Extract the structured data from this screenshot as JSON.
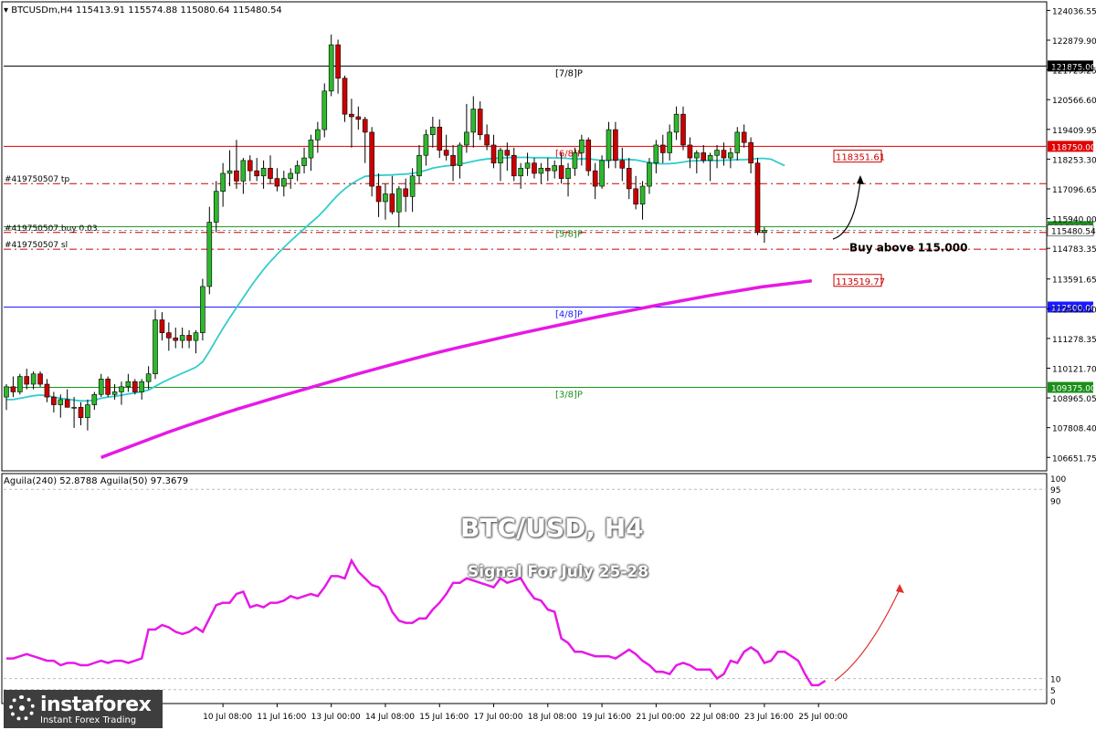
{
  "header": {
    "symbol": "BTCUSDm,H4",
    "ohlc": "115413.91 115574.88 115080.64 115480.54"
  },
  "indicator_header": "Aguila(240) 52.8788  Aguila(50) 97.3679",
  "watermark": {
    "title": "BTC/USD, H4",
    "subtitle": "Signal For July 25-28"
  },
  "logo": {
    "brand": "instaforex",
    "tagline": "Instant Forex Trading"
  },
  "colors": {
    "bull": "#2eb82e",
    "bear": "#cc0000",
    "ema_fast": "#33cccc",
    "ema_slow": "#e619e6",
    "murray_black": "#000000",
    "murray_red": "#e00000",
    "murray_green": "#1a8f1a",
    "murray_blue": "#1a1aff",
    "order_line": "#cc0000",
    "indicator": "#e619e6"
  },
  "chart_data": [
    {
      "type": "candlestick",
      "title": "BTCUSDm,H4",
      "ylim": [
        106200,
        124300
      ],
      "y_ticks": [
        124036.55,
        122879.9,
        121723.25,
        120566.6,
        119409.95,
        118253.3,
        117096.65,
        115940.0,
        114783.35,
        113591.65,
        112435.0,
        111278.35,
        110121.7,
        108965.05,
        107808.4,
        106651.75
      ],
      "x_tick_labels": [
        "10 Jul 08:00",
        "11 Jul 16:00",
        "13 Jul 00:00",
        "14 Jul 08:00",
        "15 Jul 16:00",
        "17 Jul 00:00",
        "18 Jul 08:00",
        "19 Jul 16:00",
        "21 Jul 00:00",
        "22 Jul 08:00",
        "23 Jul 16:00",
        "25 Jul 00:00"
      ],
      "x_tick_bar_index": [
        32,
        40,
        48,
        56,
        64,
        72,
        80,
        88,
        96,
        104,
        112,
        120
      ],
      "candles": [
        [
          109000,
          109500,
          108500,
          109400
        ],
        [
          109400,
          109800,
          109000,
          109200
        ],
        [
          109200,
          109900,
          109100,
          109800
        ],
        [
          109800,
          110100,
          109300,
          109500
        ],
        [
          109500,
          110000,
          109300,
          109900
        ],
        [
          109900,
          110000,
          109400,
          109500
        ],
        [
          109500,
          109700,
          108800,
          109000
        ],
        [
          109000,
          109200,
          108400,
          108700
        ],
        [
          108700,
          109100,
          108200,
          108900
        ],
        [
          108900,
          109300,
          108600,
          108600
        ],
        [
          108600,
          109000,
          107800,
          108600
        ],
        [
          108600,
          108800,
          107900,
          108200
        ],
        [
          108200,
          108900,
          107700,
          108700
        ],
        [
          108700,
          109200,
          108500,
          109100
        ],
        [
          109100,
          109900,
          109000,
          109700
        ],
        [
          109700,
          109800,
          109000,
          109100
        ],
        [
          109100,
          109500,
          108900,
          109200
        ],
        [
          109200,
          109600,
          108700,
          109400
        ],
        [
          109400,
          109900,
          109200,
          109600
        ],
        [
          109600,
          109700,
          109100,
          109200
        ],
        [
          109200,
          109700,
          108900,
          109600
        ],
        [
          109600,
          110200,
          109300,
          109900
        ],
        [
          109900,
          112400,
          109700,
          112000
        ],
        [
          112000,
          112300,
          111200,
          111500
        ],
        [
          111500,
          111900,
          110800,
          111300
        ],
        [
          111300,
          111700,
          110900,
          111200
        ],
        [
          111200,
          111700,
          110900,
          111400
        ],
        [
          111400,
          111600,
          110900,
          111200
        ],
        [
          111200,
          111600,
          110700,
          111500
        ],
        [
          111500,
          113600,
          111200,
          113300
        ],
        [
          113300,
          116400,
          113000,
          115800
        ],
        [
          115800,
          117400,
          115400,
          117000
        ],
        [
          117000,
          118100,
          116400,
          117700
        ],
        [
          117700,
          118600,
          117200,
          117800
        ],
        [
          117800,
          119000,
          117100,
          117400
        ],
        [
          117400,
          118300,
          116900,
          118200
        ],
        [
          118200,
          118400,
          117400,
          117800
        ],
        [
          117800,
          118300,
          117400,
          117600
        ],
        [
          117600,
          118200,
          117100,
          117900
        ],
        [
          117900,
          118400,
          117300,
          117500
        ],
        [
          117500,
          117900,
          117000,
          117200
        ],
        [
          117200,
          117800,
          116800,
          117500
        ],
        [
          117500,
          117900,
          117100,
          117700
        ],
        [
          117700,
          118200,
          117400,
          118000
        ],
        [
          118000,
          118700,
          117700,
          118300
        ],
        [
          118300,
          119200,
          117800,
          119000
        ],
        [
          119000,
          119700,
          118500,
          119400
        ],
        [
          119400,
          121200,
          119100,
          120900
        ],
        [
          120900,
          123100,
          120700,
          122700
        ],
        [
          122700,
          122900,
          120800,
          121400
        ],
        [
          121400,
          121500,
          119700,
          120000
        ],
        [
          120000,
          120600,
          118700,
          119900
        ],
        [
          119900,
          120300,
          119400,
          119800
        ],
        [
          119800,
          119900,
          118100,
          119300
        ],
        [
          119300,
          119500,
          116800,
          117200
        ],
        [
          117200,
          117700,
          116000,
          116600
        ],
        [
          116600,
          117300,
          115900,
          116900
        ],
        [
          116900,
          117600,
          116100,
          116200
        ],
        [
          116200,
          117200,
          115600,
          117100
        ],
        [
          117100,
          117500,
          116200,
          116800
        ],
        [
          116800,
          117900,
          116200,
          117600
        ],
        [
          117600,
          118800,
          117300,
          118400
        ],
        [
          118400,
          119400,
          118000,
          119200
        ],
        [
          119200,
          119900,
          118700,
          119500
        ],
        [
          119500,
          119800,
          118300,
          118600
        ],
        [
          118600,
          119200,
          118200,
          118400
        ],
        [
          118400,
          118800,
          117400,
          118000
        ],
        [
          118000,
          118900,
          117500,
          118800
        ],
        [
          118800,
          120400,
          118500,
          119300
        ],
        [
          119300,
          120700,
          118700,
          120200
        ],
        [
          120200,
          120500,
          119000,
          119200
        ],
        [
          119200,
          119600,
          118600,
          118800
        ],
        [
          118800,
          119200,
          117900,
          118100
        ],
        [
          118100,
          118700,
          117400,
          118600
        ],
        [
          118600,
          118900,
          117800,
          118400
        ],
        [
          118400,
          118700,
          117400,
          117600
        ],
        [
          117600,
          118100,
          117100,
          117900
        ],
        [
          117900,
          118500,
          117600,
          118100
        ],
        [
          118100,
          118300,
          117500,
          117700
        ],
        [
          117700,
          118100,
          117300,
          117900
        ],
        [
          117900,
          118300,
          117400,
          117800
        ],
        [
          117800,
          118200,
          117500,
          118000
        ],
        [
          118000,
          118500,
          117300,
          117500
        ],
        [
          117500,
          118100,
          116800,
          117900
        ],
        [
          117900,
          118700,
          117600,
          118500
        ],
        [
          118500,
          119200,
          118000,
          119000
        ],
        [
          119000,
          119100,
          117600,
          117800
        ],
        [
          117800,
          118100,
          116700,
          117200
        ],
        [
          117200,
          118400,
          117100,
          118200
        ],
        [
          118200,
          119700,
          117900,
          119400
        ],
        [
          119400,
          119700,
          117900,
          118200
        ],
        [
          118200,
          118700,
          117400,
          117900
        ],
        [
          117900,
          118300,
          116700,
          117100
        ],
        [
          117100,
          117600,
          116300,
          116500
        ],
        [
          116500,
          117400,
          115900,
          117200
        ],
        [
          117200,
          118300,
          116900,
          118100
        ],
        [
          118100,
          119000,
          117700,
          118800
        ],
        [
          118800,
          119200,
          118100,
          118500
        ],
        [
          118500,
          119600,
          118200,
          119300
        ],
        [
          119300,
          120300,
          119000,
          120000
        ],
        [
          120000,
          120300,
          118600,
          118800
        ],
        [
          118800,
          119100,
          117900,
          118300
        ],
        [
          118300,
          118600,
          117700,
          118500
        ],
        [
          118500,
          118800,
          118100,
          118200
        ],
        [
          118200,
          118500,
          117400,
          118400
        ],
        [
          118400,
          118800,
          117900,
          118600
        ],
        [
          118600,
          118900,
          118000,
          118300
        ],
        [
          118300,
          118700,
          117900,
          118500
        ],
        [
          118500,
          119500,
          118200,
          119300
        ],
        [
          119300,
          119600,
          118700,
          118900
        ],
        [
          118900,
          119100,
          117700,
          118100
        ],
        [
          118100,
          118300,
          115300,
          115400
        ],
        [
          115400,
          115600,
          115000,
          115480
        ]
      ],
      "ema_fast_values": [
        108900,
        108900,
        108950,
        109000,
        109050,
        109080,
        109050,
        109000,
        108950,
        108920,
        108880,
        108850,
        108850,
        108880,
        108950,
        109000,
        109030,
        109070,
        109120,
        109160,
        109210,
        109270,
        109420,
        109560,
        109690,
        109810,
        109930,
        110040,
        110160,
        110370,
        110780,
        111230,
        111670,
        112080,
        112470,
        112870,
        113260,
        113620,
        113960,
        114270,
        114550,
        114820,
        115070,
        115310,
        115540,
        115780,
        116010,
        116280,
        116580,
        116860,
        117100,
        117290,
        117450,
        117580,
        117610,
        117620,
        117630,
        117640,
        117660,
        117670,
        117700,
        117750,
        117820,
        117900,
        117950,
        117990,
        118020,
        118060,
        118110,
        118170,
        118220,
        118260,
        118280,
        118300,
        118310,
        118320,
        118320,
        118320,
        118310,
        118310,
        118310,
        118300,
        118300,
        118280,
        118260,
        118260,
        118270,
        118230,
        118200,
        118200,
        118240,
        118240,
        118240,
        118220,
        118170,
        118120,
        118080,
        118070,
        118080,
        118100,
        118140,
        118180,
        118190,
        118200,
        118200,
        118200,
        118210,
        118220,
        118230,
        118230,
        118250,
        118280,
        118280,
        118250,
        118120,
        118000
      ],
      "ema_slow_start_bar": 14,
      "ema_slow_values": [
        106651,
        106900,
        107150,
        107400,
        107640,
        107870,
        108090,
        108310,
        108520,
        108720,
        108920,
        109110,
        109300,
        109490,
        109680,
        109870,
        110050,
        110230,
        110410,
        110580,
        110750,
        110910,
        111060,
        111210,
        111360,
        111510,
        111650,
        111790,
        111930,
        112070,
        112200,
        112330,
        112460,
        112590,
        112710,
        112830,
        112950,
        113060,
        113170,
        113280,
        113360,
        113440,
        113519.77
      ],
      "ema_slow_label_value": 113519.77,
      "ema_fast_label_value": 118351.61,
      "murray_lines": [
        {
          "label": "[7/8]P",
          "value": 121875.0,
          "color": "black"
        },
        {
          "label": "[6/8]P",
          "value": 118750.0,
          "color": "red"
        },
        {
          "label": "[5/8]P",
          "value": 115625.0,
          "color": "green"
        },
        {
          "label": "[4/8]P",
          "value": 112500.0,
          "color": "blue"
        },
        {
          "label": "[3/8]P",
          "value": 109375.0,
          "color": "green"
        }
      ],
      "price_tag": {
        "label": "115480.54",
        "value": 115480.54
      },
      "orders": [
        {
          "label": "#419750507 tp",
          "value": 117300
        },
        {
          "label": "#419750507 buy 0.03",
          "value": 115400
        },
        {
          "label": "#419750507 sl",
          "value": 114750
        }
      ],
      "annotation": {
        "text": "Buy above 115.000",
        "price": 114800
      }
    },
    {
      "type": "line",
      "title": "Aguila(240) 52.8788  Aguila(50) 97.3679",
      "ylim": [
        0,
        100
      ],
      "y_ticks": [
        100,
        95,
        90,
        10,
        5,
        0
      ],
      "levels": [
        95,
        10,
        5
      ],
      "values": [
        19,
        19,
        20,
        21,
        20,
        19,
        18,
        18,
        16,
        17,
        17,
        16,
        16,
        17,
        18,
        17,
        18,
        18,
        17,
        18,
        19,
        32,
        32,
        34,
        33,
        31,
        30,
        31,
        33,
        31,
        37,
        43,
        44,
        44,
        48,
        49,
        42,
        43,
        42,
        44,
        44,
        45,
        47,
        46,
        47,
        48,
        47,
        51,
        56,
        56,
        55,
        63,
        58,
        55,
        52,
        51,
        47,
        40,
        36,
        35,
        35,
        37,
        37,
        41,
        44,
        48,
        53,
        53,
        55,
        54,
        53,
        52,
        51,
        55,
        53,
        54,
        55,
        50,
        46,
        45,
        41,
        40,
        28,
        26,
        22,
        22,
        21,
        20,
        20,
        20,
        19,
        21,
        23,
        21,
        18,
        16,
        13,
        13,
        12,
        16,
        17,
        16,
        14,
        14,
        14,
        10,
        12,
        18,
        17,
        22,
        24,
        22,
        17,
        18,
        22,
        22,
        20,
        18,
        12,
        7,
        7,
        9
      ],
      "arrow_note": "red upward arrow"
    }
  ]
}
